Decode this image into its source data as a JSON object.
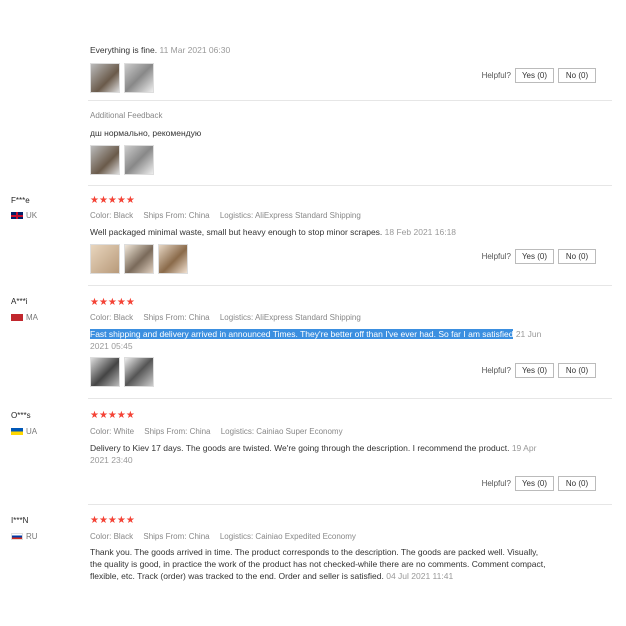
{
  "top_review": {
    "text": "Everything is fine.",
    "date": "11 Mar 2021 06:30",
    "helpful_label": "Helpful?",
    "yes_label": "Yes (0)",
    "no_label": "No (0)",
    "additional_label": "Additional Feedback",
    "additional_text": "дш нормально, рекомендую"
  },
  "reviews": [
    {
      "name": "F***e",
      "country": "UK",
      "color": "Color: Black",
      "ships": "Ships From: China",
      "logistics": "Logistics: AliExpress Standard Shipping",
      "text": "Well packaged minimal waste, small but heavy enough to stop minor scrapes.",
      "date": "18 Feb 2021 16:18",
      "helpful_label": "Helpful?",
      "yes_label": "Yes (0)",
      "no_label": "No (0)",
      "stars": "★★★★★"
    },
    {
      "name": "A***i",
      "country": "MA",
      "color": "Color: Black",
      "ships": "Ships From: China",
      "logistics": "Logistics: AliExpress Standard Shipping",
      "text": "Fast shipping and delivery arrived in announced Times. They're better off than I've ever had. So far I am satisfied",
      "date": "21 Jun 2021 05:45",
      "helpful_label": "Helpful?",
      "yes_label": "Yes (0)",
      "no_label": "No (0)",
      "stars": "★★★★★"
    },
    {
      "name": "O***s",
      "country": "UA",
      "color": "Color: White",
      "ships": "Ships From: China",
      "logistics": "Logistics: Cainiao Super Economy",
      "text": "Delivery to Kiev 17 days. The goods are twisted. We're going through the description. I recommend the product.",
      "date": "19 Apr 2021 23:40",
      "helpful_label": "Helpful?",
      "yes_label": "Yes (0)",
      "no_label": "No (0)",
      "stars": "★★★★★"
    },
    {
      "name": "I***N",
      "country": "RU",
      "color": "Color: Black",
      "ships": "Ships From: China",
      "logistics": "Logistics: Cainiao Expedited Economy",
      "text": "Thank you. The goods arrived in time. The product corresponds to the description. The goods are packed well. Visually, the quality is good, in practice the work of the product has not checked-while there are no comments. Comment compact, flexible, etc. Track (order) was tracked to the end. Order and seller is satisfied.",
      "date": "04 Jul 2021 11:41",
      "stars": "★★★★★"
    }
  ],
  "colors": {
    "star": "#f44336",
    "highlight": "#3b8fe0"
  }
}
